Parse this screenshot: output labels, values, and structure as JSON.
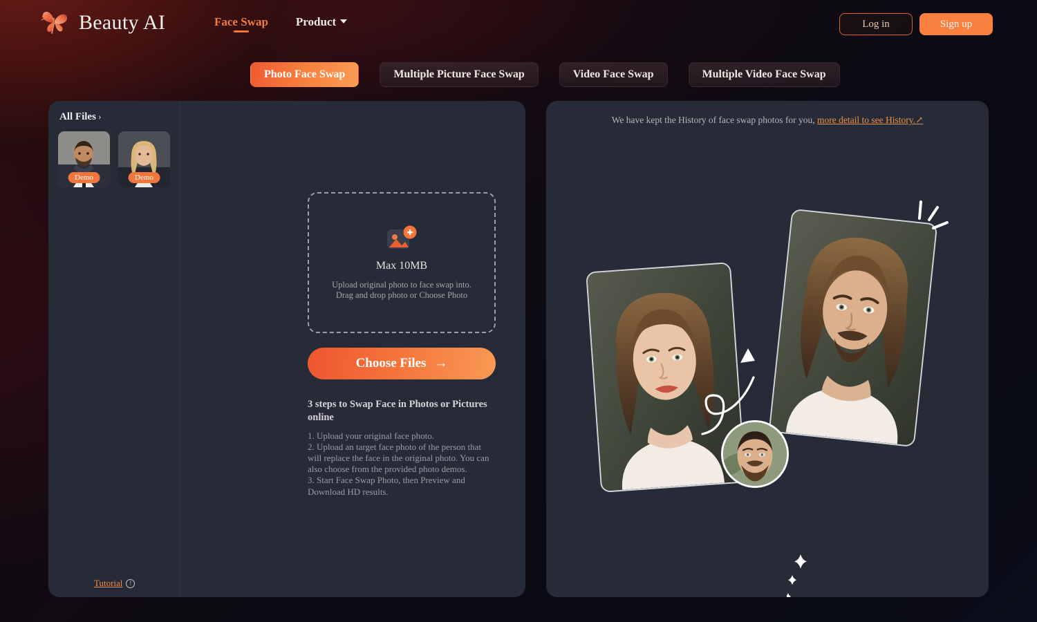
{
  "header": {
    "brand_name": "Beauty AI",
    "logo_icon": "butterfly-icon",
    "nav": [
      {
        "label": "Face Swap",
        "active": true
      },
      {
        "label": "Product",
        "active": false,
        "has_dropdown": true
      }
    ],
    "login_label": "Log in",
    "signup_label": "Sign up"
  },
  "tabs": [
    {
      "label": "Photo Face Swap",
      "active": true
    },
    {
      "label": "Multiple Picture Face Swap",
      "active": false
    },
    {
      "label": "Video Face Swap",
      "active": false
    },
    {
      "label": "Multiple Video Face Swap",
      "active": false
    }
  ],
  "sidebar": {
    "all_files_label": "All Files",
    "all_files_chevron": "›",
    "thumbnails": [
      {
        "badge": "Demo",
        "subject": "man-in-suit"
      },
      {
        "badge": "Demo",
        "subject": "blonde-woman"
      }
    ],
    "tutorial_label": "Tutorial",
    "tutorial_icon": "exclamation-circle-icon",
    "tutorial_icon_glyph": "!"
  },
  "upload": {
    "icon": "image-plus-icon",
    "max_size": "Max 10MB",
    "hint_line1": "Upload original photo to face swap into.",
    "hint_line2": "Drag and drop photo or Choose Photo",
    "choose_files_label": "Choose Files",
    "choose_files_arrow": "→",
    "steps_title": "3 steps to Swap Face in Photos or Pictures online",
    "steps_body": "1. Upload your original face photo.\n2. Upload an target face photo of the person that will replace the face in the original photo. You can also choose from the provided photo demos.\n3. Start Face Swap Photo, then Preview and Download HD results."
  },
  "history": {
    "note": "We have kept the History of face swap photos for you,",
    "link_label": "more detail to see History.↗"
  },
  "illustration": {
    "source_card": "woman-portrait-card",
    "result_card": "man-portrait-card",
    "source_face": "man-face-avatar",
    "arrow": "curved-arrow-icon",
    "sparkles": "sparkle-icons"
  },
  "colors": {
    "accent": "#f4753c",
    "accent_light": "#f99a53",
    "panel": "#262b37",
    "page_dark": "#0b0d1a",
    "page_maroon": "#4a1311",
    "text_primary": "#efe9e6",
    "text_muted": "#9e9aa2"
  }
}
